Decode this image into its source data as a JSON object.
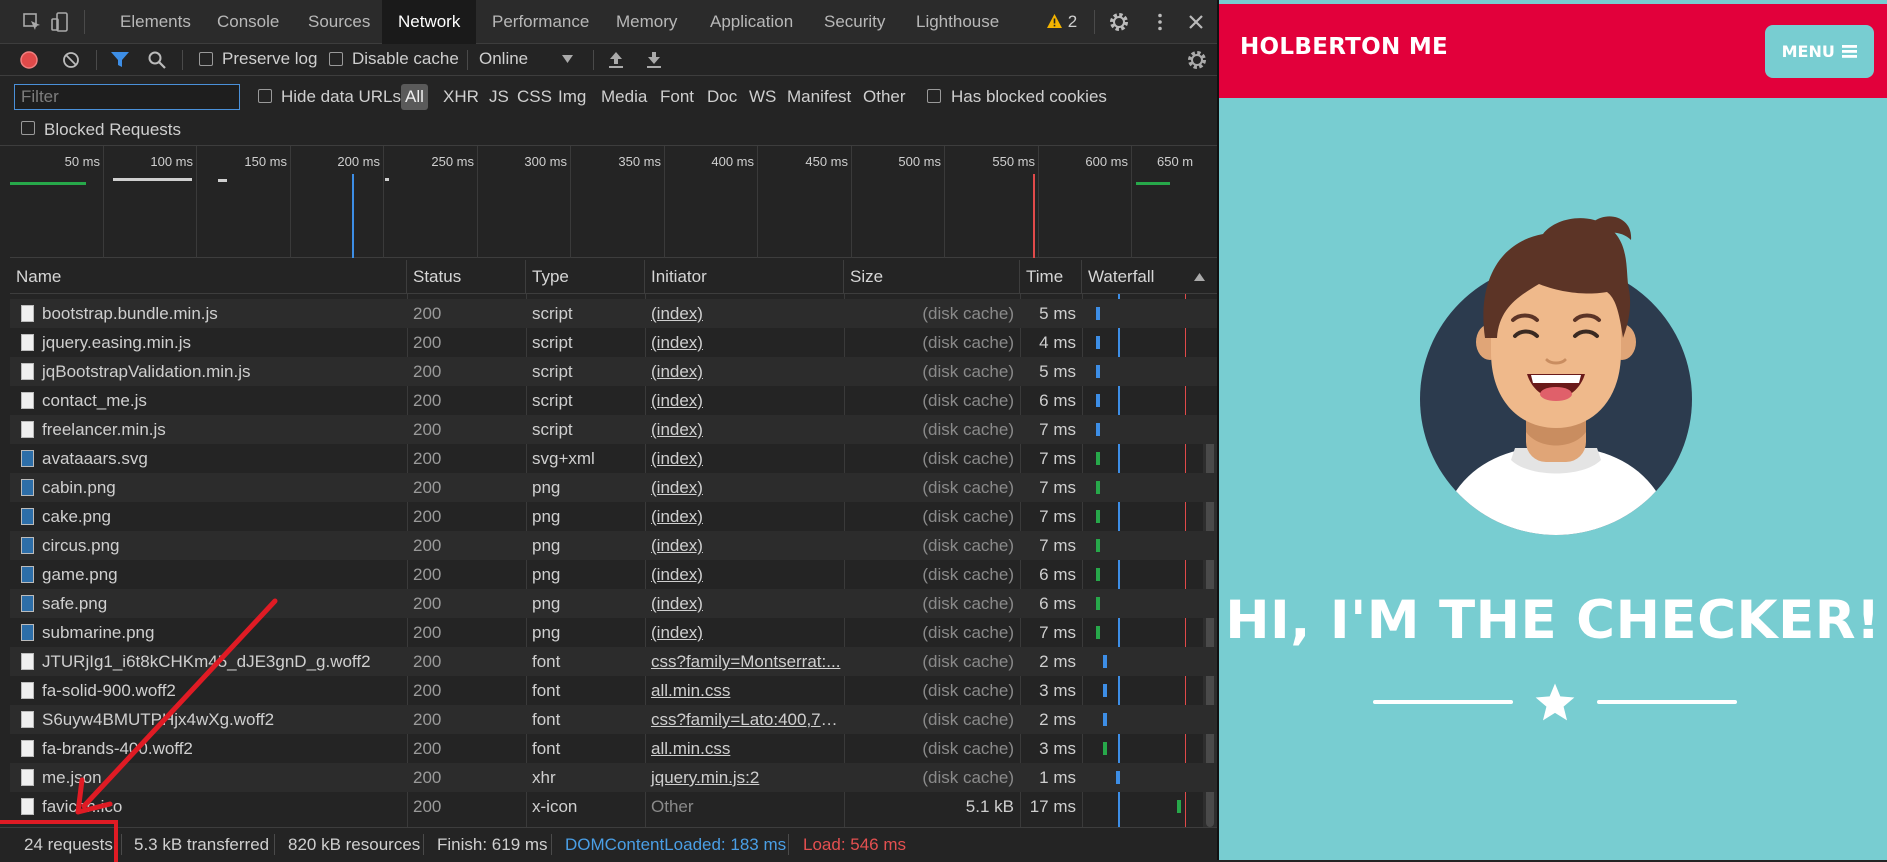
{
  "devtools": {
    "tabs": [
      "Elements",
      "Console",
      "Sources",
      "Network",
      "Performance",
      "Memory",
      "Application",
      "Security",
      "Lighthouse"
    ],
    "active_tab": "Network",
    "warnings_count": "2",
    "toolbar": {
      "preserve_log": "Preserve log",
      "disable_cache": "Disable cache",
      "throttle": "Online"
    },
    "filter": {
      "placeholder": "Filter",
      "hide_data_urls": "Hide data URLs",
      "types": [
        "All",
        "XHR",
        "JS",
        "CSS",
        "Img",
        "Media",
        "Font",
        "Doc",
        "WS",
        "Manifest",
        "Other"
      ],
      "has_blocked_cookies": "Has blocked cookies",
      "blocked_requests": "Blocked Requests"
    },
    "overview_ticks": [
      "50 ms",
      "100 ms",
      "150 ms",
      "200 ms",
      "250 ms",
      "300 ms",
      "350 ms",
      "400 ms",
      "450 ms",
      "500 ms",
      "550 ms",
      "600 ms",
      "650 m"
    ],
    "columns": [
      "Name",
      "Status",
      "Type",
      "Initiator",
      "Size",
      "Time",
      "Waterfall"
    ],
    "rows": [
      {
        "name": "bootstrap.bundle.min.js",
        "status": "200",
        "type": "script",
        "initiator": "(index)",
        "size": "(disk cache)",
        "time": "5 ms",
        "icon": "file-icon"
      },
      {
        "name": "jquery.easing.min.js",
        "status": "200",
        "type": "script",
        "initiator": "(index)",
        "size": "(disk cache)",
        "time": "4 ms",
        "icon": "file-icon"
      },
      {
        "name": "jqBootstrapValidation.min.js",
        "status": "200",
        "type": "script",
        "initiator": "(index)",
        "size": "(disk cache)",
        "time": "5 ms",
        "icon": "file-icon"
      },
      {
        "name": "contact_me.js",
        "status": "200",
        "type": "script",
        "initiator": "(index)",
        "size": "(disk cache)",
        "time": "6 ms",
        "icon": "file-icon"
      },
      {
        "name": "freelancer.min.js",
        "status": "200",
        "type": "script",
        "initiator": "(index)",
        "size": "(disk cache)",
        "time": "7 ms",
        "icon": "file-icon"
      },
      {
        "name": "avataaars.svg",
        "status": "200",
        "type": "svg+xml",
        "initiator": "(index)",
        "size": "(disk cache)",
        "time": "7 ms",
        "icon": "image-icon"
      },
      {
        "name": "cabin.png",
        "status": "200",
        "type": "png",
        "initiator": "(index)",
        "size": "(disk cache)",
        "time": "7 ms",
        "icon": "image-icon"
      },
      {
        "name": "cake.png",
        "status": "200",
        "type": "png",
        "initiator": "(index)",
        "size": "(disk cache)",
        "time": "7 ms",
        "icon": "image-icon"
      },
      {
        "name": "circus.png",
        "status": "200",
        "type": "png",
        "initiator": "(index)",
        "size": "(disk cache)",
        "time": "7 ms",
        "icon": "image-icon"
      },
      {
        "name": "game.png",
        "status": "200",
        "type": "png",
        "initiator": "(index)",
        "size": "(disk cache)",
        "time": "6 ms",
        "icon": "image-icon"
      },
      {
        "name": "safe.png",
        "status": "200",
        "type": "png",
        "initiator": "(index)",
        "size": "(disk cache)",
        "time": "6 ms",
        "icon": "image-icon"
      },
      {
        "name": "submarine.png",
        "status": "200",
        "type": "png",
        "initiator": "(index)",
        "size": "(disk cache)",
        "time": "7 ms",
        "icon": "image-icon"
      },
      {
        "name": "JTURjIg1_i6t8kCHKm45_dJE3gnD_g.woff2",
        "status": "200",
        "type": "font",
        "initiator": "css?family=Montserrat:...",
        "size": "(disk cache)",
        "time": "2 ms",
        "icon": "file-icon"
      },
      {
        "name": "fa-solid-900.woff2",
        "status": "200",
        "type": "font",
        "initiator": "all.min.css",
        "size": "(disk cache)",
        "time": "3 ms",
        "icon": "file-icon"
      },
      {
        "name": "S6uyw4BMUTPHjx4wXg.woff2",
        "status": "200",
        "type": "font",
        "initiator": "css?family=Lato:400,70...",
        "size": "(disk cache)",
        "time": "2 ms",
        "icon": "file-icon"
      },
      {
        "name": "fa-brands-400.woff2",
        "status": "200",
        "type": "font",
        "initiator": "all.min.css",
        "size": "(disk cache)",
        "time": "3 ms",
        "icon": "file-icon"
      },
      {
        "name": "me.json",
        "status": "200",
        "type": "xhr",
        "initiator": "jquery.min.js:2",
        "size": "(disk cache)",
        "time": "1 ms",
        "icon": "file-icon"
      },
      {
        "name": "favicon.ico",
        "status": "200",
        "type": "x-icon",
        "initiator": "Other",
        "size": "5.1 kB",
        "time": "17 ms",
        "icon": "file-icon"
      }
    ],
    "statusbar": {
      "requests": "24 requests",
      "transferred": "5.3 kB transferred",
      "resources": "820 kB resources",
      "finish": "Finish: 619 ms",
      "dom_content_loaded": "DOMContentLoaded: 183 ms",
      "load": "Load: 546 ms"
    }
  },
  "website": {
    "brand": "HOLBERTON ME",
    "menu_label": "MENU",
    "hero_title": "HI, I'M THE CHECKER!"
  },
  "colors": {
    "navbar": "#e2003b",
    "hero_bg": "#78cdd1",
    "dom_content_loaded": "#4a9fe6",
    "load": "#e45050",
    "annotation": "#e01b24"
  }
}
